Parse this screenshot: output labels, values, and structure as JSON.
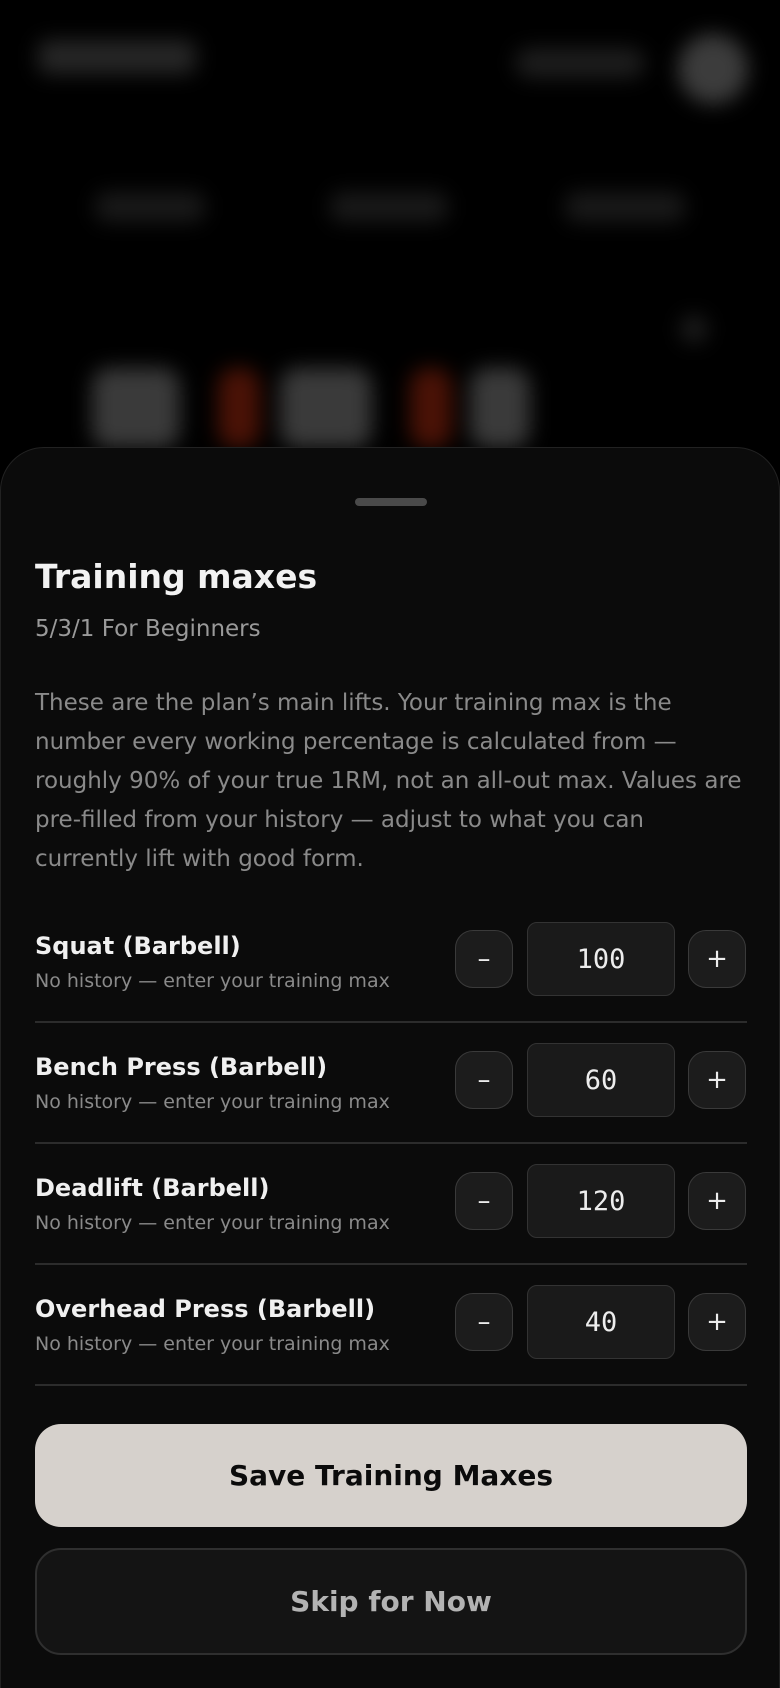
{
  "sheet": {
    "title": "Training maxes",
    "subtitle": "5/3/1 For Beginners",
    "description": "These are the plan’s main lifts. Your training max is the number every working percentage is calculated from — roughly 90% of your true 1RM, not an all-out max. Values are pre-filled from your history — adjust to what you can currently lift with good form."
  },
  "stepper": {
    "decrement_label": "–",
    "increment_label": "+"
  },
  "lifts": [
    {
      "name": "Squat (Barbell)",
      "hint": "No history — enter your training max",
      "value": "100"
    },
    {
      "name": "Bench Press (Barbell)",
      "hint": "No history — enter your training max",
      "value": "60"
    },
    {
      "name": "Deadlift (Barbell)",
      "hint": "No history — enter your training max",
      "value": "120"
    },
    {
      "name": "Overhead Press (Barbell)",
      "hint": "No history — enter your training max",
      "value": "40"
    }
  ],
  "actions": {
    "save_label": "Save Training Maxes",
    "skip_label": "Skip for Now"
  },
  "colors": {
    "background": "#000000",
    "sheet": "#0b0b0b",
    "primary_button": "#d6d1cc",
    "secondary_button": "#141414",
    "text_primary": "#f0f0f0",
    "text_muted": "#8a8a8a"
  }
}
